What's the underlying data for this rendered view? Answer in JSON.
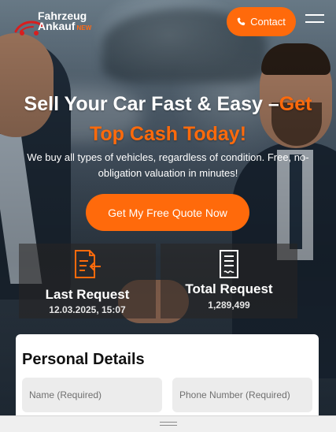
{
  "colors": {
    "accent": "#ff6a0b",
    "text_light": "#ffffff",
    "field_bg": "#ececec"
  },
  "header": {
    "logo": {
      "line1": "Fahrzeug",
      "line2": "Ankauf",
      "badge": "NEW"
    },
    "contact_label": "Contact",
    "menu_icon": "hamburger-icon"
  },
  "hero": {
    "headline_part1": "Sell Your Car Fast & Easy –",
    "headline_part2": "Get",
    "headline_line2": "Top Cash Today!",
    "subtext": "We buy all types of vehicles, regardless of condition. Free, no-obligation valuation in minutes!",
    "cta_label": "Get My Free Quote Now"
  },
  "stats": [
    {
      "icon": "request-document-icon",
      "title": "Last Request",
      "value": "12.03.2025, 15:07"
    },
    {
      "icon": "list-document-icon",
      "title": "Total Request",
      "value": "1,289,499"
    }
  ],
  "form": {
    "title": "Personal Details",
    "name_placeholder": "Name (Required)",
    "phone_placeholder": "Phone Number (Required)"
  }
}
